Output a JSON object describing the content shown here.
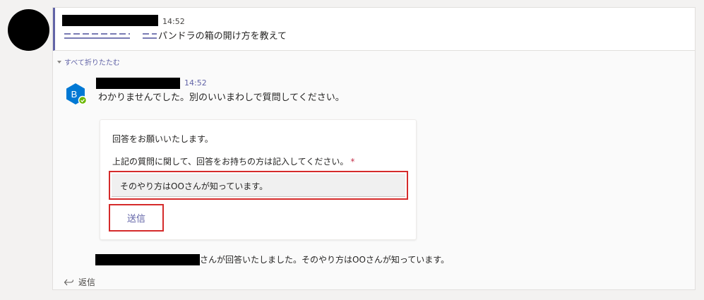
{
  "post": {
    "time": "14:52",
    "title": "パンドラの箱の開け方を教えて"
  },
  "collapse_label": "すべて折りたたむ",
  "bot": {
    "avatar_letter": "B",
    "time": "14:52",
    "message": "わかりませんでした。別のいいまわしで質問してください。"
  },
  "card": {
    "title": "回答をお願いいたします。",
    "question": "上記の質問に関して、回答をお持ちの方は記入してください。",
    "required_mark": "*",
    "input_value": "そのやり方はOOさんが知っています。",
    "send_label": "送信"
  },
  "reply_message": "さんが回答いたしました。そのやり方はOOさんが知っています。",
  "reply_link_label": "返信",
  "colors": {
    "accent": "#6264a7",
    "highlight_red": "#d52b2b",
    "bot_blue": "#0078d4",
    "status_green": "#6bb700"
  },
  "icons": {
    "collapse": "triangle-down-icon",
    "reply": "reply-arrow-icon",
    "bot_status": "check-circle-icon"
  }
}
